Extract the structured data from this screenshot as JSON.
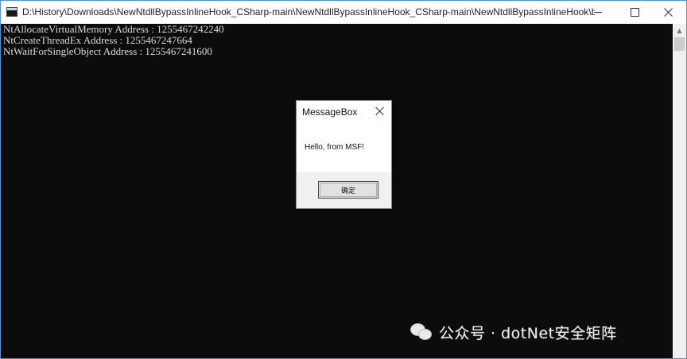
{
  "window": {
    "title": "D:\\History\\Downloads\\NewNtdllBypassInlineHook_CSharp-main\\NewNtdllBypassInlineHook_CSharp-main\\NewNtdllBypassInlineHook\\bin\\...",
    "icons": {
      "minimize": "minimize-icon",
      "maximize": "maximize-icon",
      "close": "close-icon"
    }
  },
  "console": {
    "lines": [
      "NtAllocateVirtualMemory Address : 1255467242240",
      "NtCreateThreadEx Address : 1255467247664",
      "NtWaitForSingleObject Address : 1255467241600"
    ]
  },
  "dialog": {
    "title": "MessageBox",
    "message": "Hello, from MSF!",
    "ok_label": "确定"
  },
  "watermark": {
    "text": "公众号 · dotNet安全矩阵"
  }
}
